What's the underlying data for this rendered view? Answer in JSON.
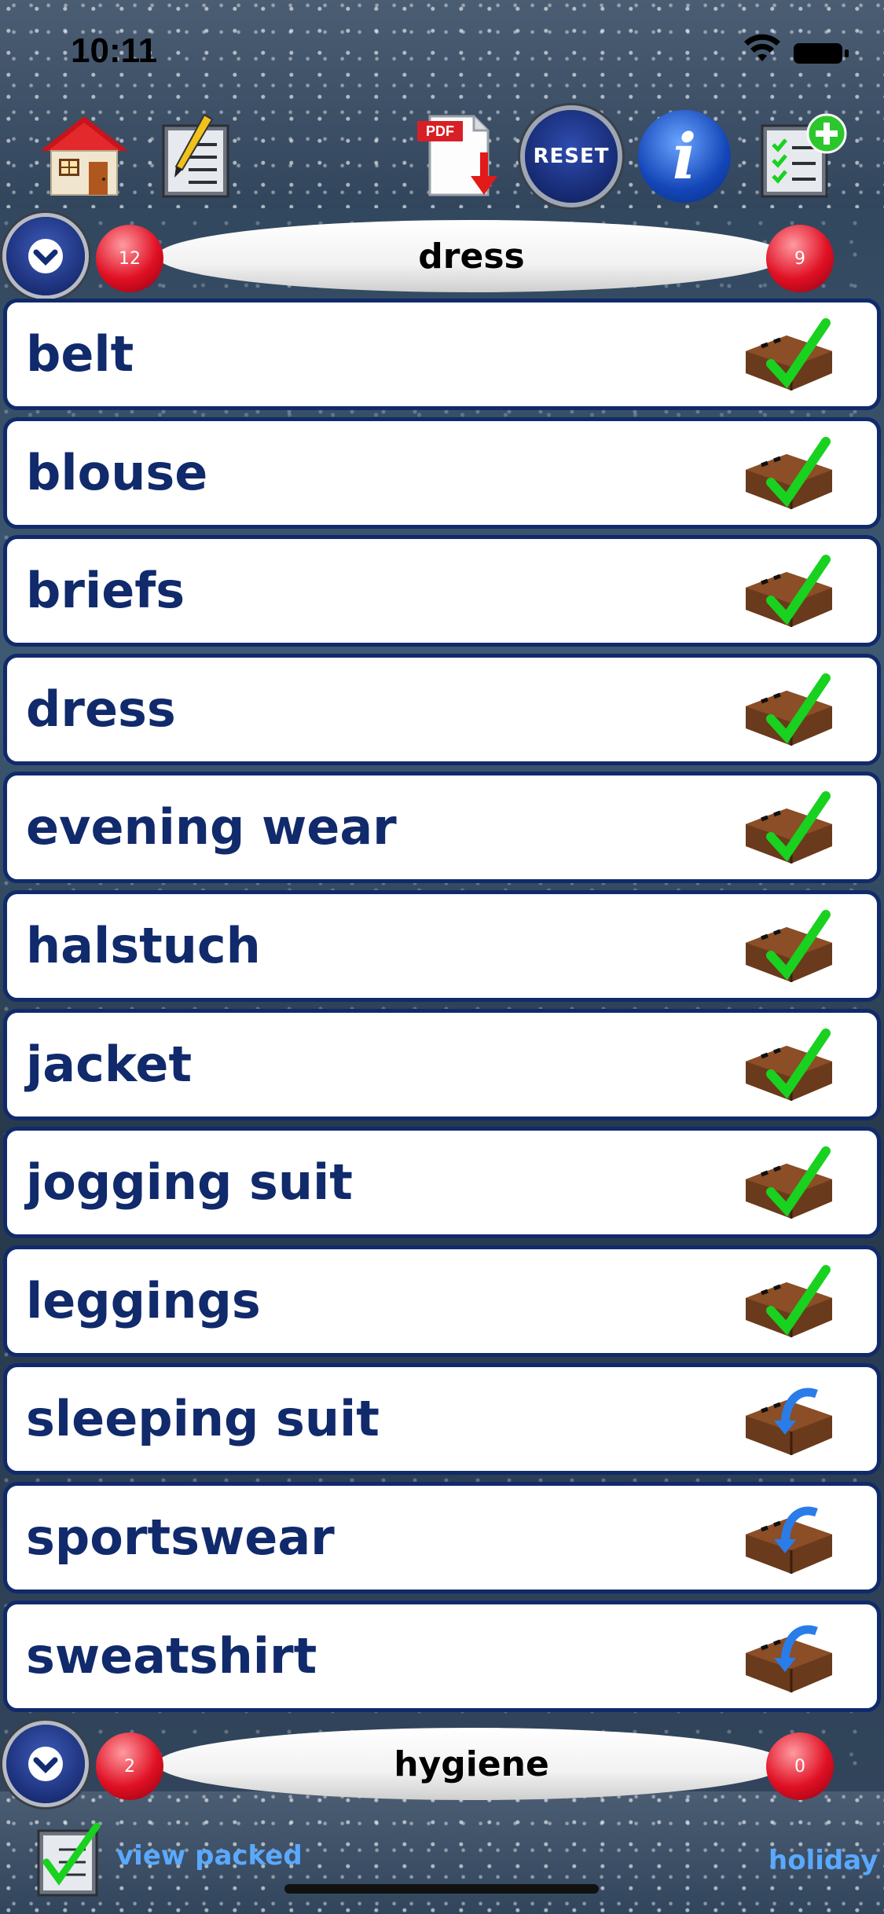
{
  "status_bar": {
    "time": "10:11"
  },
  "toolbar": {
    "pdf_label": "PDF",
    "reset_label": "RESET",
    "info_label": "i"
  },
  "sections": [
    {
      "title": "dress",
      "count_total": "12",
      "count_packed": "9"
    },
    {
      "title": "hygiene",
      "count_total": "2",
      "count_packed": "0"
    }
  ],
  "items": [
    {
      "label": "belt",
      "status": "packed"
    },
    {
      "label": "blouse",
      "status": "packed"
    },
    {
      "label": "briefs",
      "status": "packed"
    },
    {
      "label": "dress",
      "status": "packed"
    },
    {
      "label": "evening wear",
      "status": "packed"
    },
    {
      "label": "halstuch",
      "status": "packed"
    },
    {
      "label": "jacket",
      "status": "packed"
    },
    {
      "label": "jogging suit",
      "status": "packed"
    },
    {
      "label": "leggings",
      "status": "packed"
    },
    {
      "label": "sleeping suit",
      "status": "to-pack"
    },
    {
      "label": "sportswear",
      "status": "to-pack"
    },
    {
      "label": "sweatshirt",
      "status": "to-pack"
    }
  ],
  "bottom_bar": {
    "view_packed_label": "view packed",
    "holiday_label": "holiday"
  },
  "colors": {
    "item_text": "#102a6b",
    "item_border": "#102a6b",
    "badge_red": "#e01024",
    "link_blue": "#5aa9ff",
    "check_green": "#19d11f",
    "arrow_blue": "#2a7de8",
    "suitcase_brown": "#6a3a1c"
  }
}
